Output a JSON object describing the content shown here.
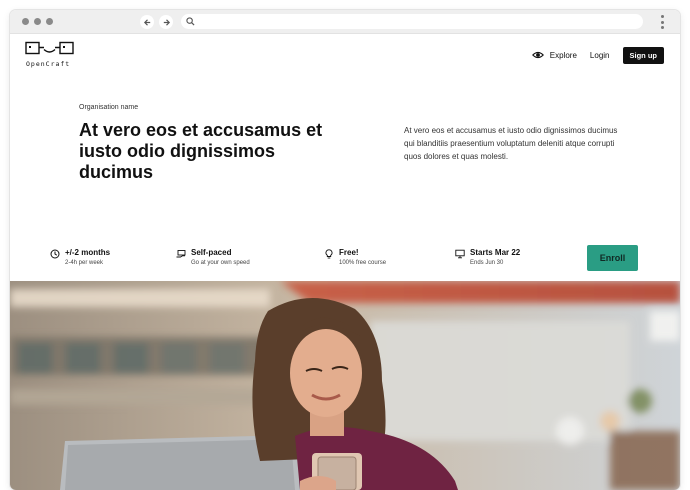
{
  "site": {
    "logo_text": "OpenCraft",
    "nav": {
      "explore": "Explore",
      "login": "Login",
      "signup": "Sign up"
    }
  },
  "hero": {
    "org_name": "Organisation name",
    "headline": "At vero eos et accusamus et iusto odio dignissimos ducimus",
    "description": "At vero eos et accusamus et iusto odio dignissimos ducimus qui blanditiis praesentium voluptatum deleniti atque corrupti quos dolores et quas molesti."
  },
  "course_info": [
    {
      "icon": "clock-icon",
      "title": "+/-2 months",
      "subtitle": "2-4h per week"
    },
    {
      "icon": "laptop-hand-icon",
      "title": "Self-paced",
      "subtitle": "Go at your own speed"
    },
    {
      "icon": "lightbulb-icon",
      "title": "Free!",
      "subtitle": "100% free course"
    },
    {
      "icon": "monitor-icon",
      "title": "Starts Mar 22",
      "subtitle": "Ends Jun 30"
    }
  ],
  "enroll_label": "Enroll",
  "colors": {
    "accent": "#2a9d84",
    "dark": "#111111",
    "chrome": "#efefef"
  }
}
